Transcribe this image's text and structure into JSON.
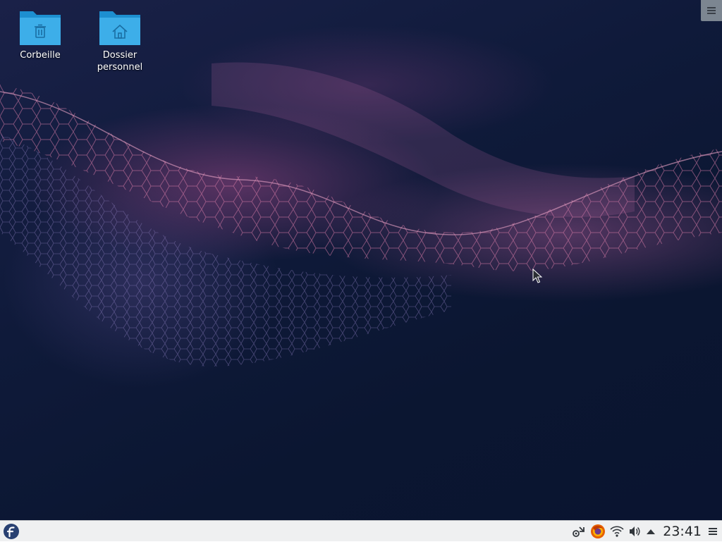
{
  "desktop": {
    "icons": [
      {
        "label": "Corbeille",
        "icon": "trash-folder-icon"
      },
      {
        "label": "Dossier personnel",
        "icon": "home-folder-icon"
      }
    ]
  },
  "taskbar": {
    "launcher_icon": "fedora-logo-icon",
    "tray": {
      "icons": [
        "updates-icon",
        "firefox-icon",
        "wifi-icon",
        "volume-icon",
        "expand-tray-arrow-icon"
      ],
      "clock": "23:41"
    },
    "menu_icon": "hamburger-menu-icon"
  },
  "colors": {
    "taskbar_bg": "#eff0f1",
    "folder_blue": "#3daee9",
    "fedora_blue": "#294172",
    "desktop_bg": "#0b1631"
  }
}
